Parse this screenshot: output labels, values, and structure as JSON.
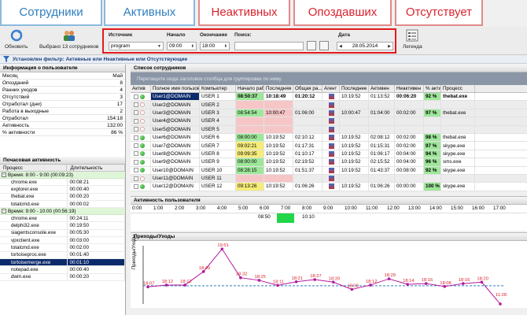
{
  "tabs": [
    {
      "label": "Сотрудники",
      "style": "blue"
    },
    {
      "label": "Активных",
      "style": "blue"
    },
    {
      "label": "Неактивных",
      "style": "red"
    },
    {
      "label": "Опоздавших",
      "style": "red"
    },
    {
      "label": "Отсутствует",
      "style": "red"
    }
  ],
  "toolbar": {
    "refresh_label": "Обновить",
    "selected_label": "Выбрано 13 сотрудников",
    "legend_label": "Легенда"
  },
  "filter": {
    "source_label": "Источник",
    "source_value": "program",
    "start_label": "Начало",
    "start_value": "09:00",
    "end_label": "Окончание",
    "end_value": "18:00",
    "search_label": "Поиск:",
    "search_value": "",
    "date_label": "Дата",
    "date_value": "28.05.2014"
  },
  "status": {
    "text": "Установлен фильтр: Активные или Неактивные или Отсутствующие"
  },
  "user_info": {
    "title": "Информация о пользователе",
    "rows": [
      {
        "k": "Месяц",
        "v": "Май"
      },
      {
        "k": "Опозданий",
        "v": "8"
      },
      {
        "k": "Ранних уходов",
        "v": "4"
      },
      {
        "k": "Отсутствий",
        "v": "3"
      },
      {
        "k": "Отработал (дни)",
        "v": "17"
      },
      {
        "k": "Работа в выходные",
        "v": "2"
      },
      {
        "k": "Отработал",
        "v": "154:18"
      },
      {
        "k": "Активность",
        "v": "132:00"
      },
      {
        "k": "% активности",
        "v": "86 %"
      }
    ]
  },
  "hourly": {
    "title": "Почасовая активность",
    "col_process": "Процесс",
    "col_duration": "Длительность",
    "groups": [
      {
        "label": "Время: 8:00 - 9:00 (00:09:23)",
        "rows": [
          {
            "p": "chrome.exe",
            "d": "00:08:21"
          },
          {
            "p": "explorer.exe",
            "d": "00:00:40"
          },
          {
            "p": "thebat.exe",
            "d": "00:00:20"
          },
          {
            "p": "totalcmd.exe",
            "d": "00:00:02"
          }
        ]
      },
      {
        "label": "Время: 9:00 - 10:00 (00:56:19)",
        "rows": [
          {
            "p": "chrome.exe",
            "d": "00:24:11"
          },
          {
            "p": "delphi32.exe",
            "d": "00:19:50"
          },
          {
            "p": "siagentsconsole.exe",
            "d": "00:05:30"
          },
          {
            "p": "vpxclient.exe",
            "d": "00:03:00"
          },
          {
            "p": "totalcmd.exe",
            "d": "00:02:00"
          },
          {
            "p": "tortoiseproc.exe",
            "d": "00:01:40"
          },
          {
            "p": "tortoisemerge.exe",
            "d": "00:01:10"
          },
          {
            "p": "notepad.exe",
            "d": "00:00:40"
          },
          {
            "p": "dwm.exe",
            "d": "00:00:20"
          }
        ]
      }
    ]
  },
  "employees": {
    "title": "Список сотрудников",
    "group_hint": "Перетащите сюда заголовок столбца для группировки по нему",
    "columns": [
      "Актив",
      "Полное имя пользоват...",
      "Компьютер",
      "Начало раб",
      "Последняя",
      "Общая ра...",
      "Агент",
      "Последнее",
      "Активен",
      "Неактивен",
      "% актив",
      "Процесс"
    ],
    "rows": [
      {
        "name": "User1@DOMAIN",
        "pc": "USER 1",
        "start": "08:50:37",
        "last": "10:18:49",
        "total": "01:20:12",
        "lastact": "10:19:52",
        "active": "01:13:52",
        "inactive": "00:06:20",
        "pct": "92 %",
        "proc": "thebat.exe",
        "online": true,
        "start_c": "g",
        "last_c": "",
        "bold": true
      },
      {
        "name": "User2@DOMAIN",
        "pc": "USER 2",
        "start": "",
        "last": "",
        "total": "",
        "lastact": "",
        "active": "",
        "inactive": "",
        "pct": "",
        "proc": "",
        "online": false,
        "start_c": "r",
        "last_c": "r",
        "bold": false
      },
      {
        "name": "User3@DOMAIN",
        "pc": "USER 3",
        "start": "08:54:54",
        "last": "10:00:47",
        "total": "01:06:00",
        "lastact": "10:00:47",
        "active": "01:04:00",
        "inactive": "00:02:00",
        "pct": "97 %",
        "proc": "thebat.exe",
        "online": false,
        "start_c": "g",
        "last_c": "r",
        "bold": false
      },
      {
        "name": "User4@DOMAIN",
        "pc": "USER 4",
        "start": "",
        "last": "",
        "total": "",
        "lastact": "",
        "active": "",
        "inactive": "",
        "pct": "",
        "proc": "",
        "online": false,
        "start_c": "r",
        "last_c": "r",
        "bold": false
      },
      {
        "name": "User5@DOMAIN",
        "pc": "USER 5",
        "start": "",
        "last": "",
        "total": "",
        "lastact": "",
        "active": "",
        "inactive": "",
        "pct": "",
        "proc": "",
        "online": false,
        "start_c": "r",
        "last_c": "r",
        "bold": false
      },
      {
        "name": "User6@DOMAIN",
        "pc": "USER 6",
        "start": "08:00:00",
        "last": "10:19:52",
        "total": "02:10:12",
        "lastact": "10:19:52",
        "active": "02:08:12",
        "inactive": "00:02:00",
        "pct": "98 %",
        "proc": "thebat.exe",
        "online": true,
        "start_c": "g",
        "last_c": "",
        "bold": false
      },
      {
        "name": "User7@DOMAIN",
        "pc": "USER 7",
        "start": "09:02:21",
        "last": "10:19:52",
        "total": "01:17:31",
        "lastact": "10:19:52",
        "active": "01:15:31",
        "inactive": "00:02:00",
        "pct": "97 %",
        "proc": "skype.exe",
        "online": true,
        "start_c": "y",
        "last_c": "",
        "bold": false
      },
      {
        "name": "User8@DOMAIN",
        "pc": "USER 8",
        "start": "09:09:35",
        "last": "10:19:52",
        "total": "01:10:17",
        "lastact": "10:19:52",
        "active": "01:06:17",
        "inactive": "00:04:00",
        "pct": "94 %",
        "proc": "skype.exe",
        "online": true,
        "start_c": "y",
        "last_c": "",
        "bold": false
      },
      {
        "name": "User9@DOMAIN",
        "pc": "USER 9",
        "start": "08:00:00",
        "last": "10:19:52",
        "total": "02:19:52",
        "lastact": "10:19:52",
        "active": "02:15:52",
        "inactive": "00:04:00",
        "pct": "96 %",
        "proc": "sms.exe",
        "online": true,
        "start_c": "g",
        "last_c": "",
        "bold": false
      },
      {
        "name": "User10@DOMAIN",
        "pc": "USER 10",
        "start": "08:28:15",
        "last": "10:19:52",
        "total": "01:51:37",
        "lastact": "10:19:52",
        "active": "01:43:37",
        "inactive": "00:08:00",
        "pct": "92 %",
        "proc": "skype.exe",
        "online": true,
        "start_c": "g",
        "last_c": "",
        "bold": false
      },
      {
        "name": "User11@DOMAIN",
        "pc": "USER 11",
        "start": "",
        "last": "",
        "total": "",
        "lastact": "",
        "active": "",
        "inactive": "",
        "pct": "",
        "proc": "",
        "online": false,
        "start_c": "r",
        "last_c": "r",
        "bold": false
      },
      {
        "name": "User12@DOMAIN",
        "pc": "USER 12",
        "start": "09:13:26",
        "last": "10:19:52",
        "total": "01:06:26",
        "lastact": "10:19:52",
        "active": "01:06:26",
        "inactive": "00:00:00",
        "pct": "100 %",
        "proc": "skype.exe",
        "online": true,
        "start_c": "y",
        "last_c": "",
        "bold": false
      }
    ]
  },
  "activity": {
    "title": "Активность пользователя",
    "hours": [
      "0:00",
      "1:00",
      "2:00",
      "3:00",
      "4:00",
      "5:00",
      "6:00",
      "7:00",
      "8:00",
      "9:00",
      "10:00",
      "11:00",
      "12:00",
      "13:00",
      "14:00",
      "15:00",
      "16:00",
      "17:00"
    ],
    "start_mark": "08:50",
    "end_mark": "10:10"
  },
  "arrivals": {
    "title": "Приходы/Уходы",
    "ylabel": "Приходы/Уходы",
    "labels": [
      "18:07",
      "18:12",
      "18:12",
      "18:49",
      "19:51",
      "18:32",
      "18:25",
      "18:11",
      "18:21",
      "18:27",
      "18:20",
      "18:00",
      "18:12",
      "18:29",
      "18:14",
      "18:16",
      "18:08",
      "18:16",
      "18:20",
      "11:28"
    ]
  },
  "colors": {
    "accent": "#2f7fc0",
    "alert": "#d9232d",
    "highlight": "#e21b1b",
    "selection": "#0b2a6b",
    "line": "#b5179e",
    "green": "#9ee79a",
    "yellow": "#f6ec7a"
  }
}
